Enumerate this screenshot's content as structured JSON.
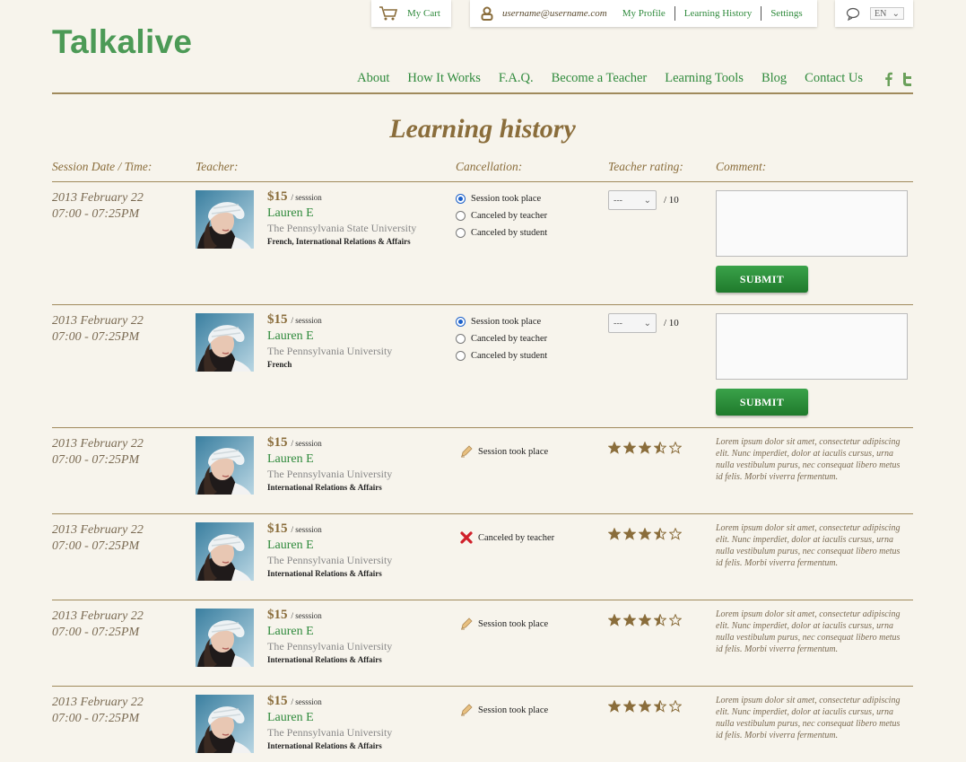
{
  "brand": {
    "logo": "Talkalive"
  },
  "topbar": {
    "cart": "My Cart",
    "email": "username@username.com",
    "links": [
      "My Profile",
      "Learning History",
      "Settings"
    ],
    "language": "EN"
  },
  "nav": [
    "About",
    "How It Works",
    "F.A.Q.",
    "Become a Teacher",
    "Learning Tools",
    "Blog",
    "Contact Us"
  ],
  "page_title": "Learning history",
  "columns": {
    "date": "Session Date / Time:",
    "teacher": "Teacher:",
    "cancellation": "Cancellation:",
    "rating": "Teacher rating:",
    "comment": "Comment:"
  },
  "pending_rows": [
    {
      "date": "2013 February 22",
      "time": "07:00 - 07:25PM",
      "price": "$15",
      "per": "/ sesssion",
      "teacher": "Lauren E",
      "university": "The Pennsylvania State University",
      "subjects": "French, International Relations & Affairs",
      "options": [
        "Session took place",
        "Canceled by teacher",
        "Canceled by student"
      ],
      "rating_value": "---",
      "rating_max": "/ 10",
      "submit": "SUBMIT"
    },
    {
      "date": "2013 February 22",
      "time": "07:00 - 07:25PM",
      "price": "$15",
      "per": "/ sesssion",
      "teacher": "Lauren E",
      "university": "The Pennsylvania University",
      "subjects": "French",
      "options": [
        "Session took place",
        "Canceled by teacher",
        "Canceled by student"
      ],
      "rating_value": "---",
      "rating_max": "/ 10",
      "submit": "SUBMIT"
    }
  ],
  "rated_rows": [
    {
      "date": "2013 February 22",
      "time": "07:00 - 07:25PM",
      "price": "$15",
      "per": "/ sesssion",
      "teacher": "Lauren E",
      "university": "The Pennsylvania University",
      "subjects": "International Relations & Affairs",
      "status": "Session took place",
      "status_icon": "pencil-check-icon",
      "rating": 3.5,
      "comment": "Lorem ipsum dolor sit amet, consectetur adipiscing elit. Nunc imperdiet, dolor at iaculis cursus, urna nulla vestibulum purus, nec consequat libero metus id felis. Morbi viverra fermentum."
    },
    {
      "date": "2013 February 22",
      "time": "07:00 - 07:25PM",
      "price": "$15",
      "per": "/ sesssion",
      "teacher": "Lauren E",
      "university": "The Pennsylvania University",
      "subjects": "International Relations & Affairs",
      "status": "Canceled by teacher",
      "status_icon": "red-x-icon",
      "rating": 3.5,
      "comment": "Lorem ipsum dolor sit amet, consectetur adipiscing elit. Nunc imperdiet, dolor at iaculis cursus, urna nulla vestibulum purus, nec consequat libero metus id felis. Morbi viverra fermentum."
    },
    {
      "date": "2013 February 22",
      "time": "07:00 - 07:25PM",
      "price": "$15",
      "per": "/ sesssion",
      "teacher": "Lauren E",
      "university": "The Pennsylvania University",
      "subjects": "International Relations & Affairs",
      "status": "Session took place",
      "status_icon": "pencil-check-icon",
      "rating": 3.5,
      "comment": "Lorem ipsum dolor sit amet, consectetur adipiscing elit. Nunc imperdiet, dolor at iaculis cursus, urna nulla vestibulum purus, nec consequat libero metus id felis. Morbi viverra fermentum."
    },
    {
      "date": "2013 February 22",
      "time": "07:00 - 07:25PM",
      "price": "$15",
      "per": "/ sesssion",
      "teacher": "Lauren E",
      "university": "The Pennsylvania University",
      "subjects": "International Relations & Affairs",
      "status": "Session took place",
      "status_icon": "pencil-check-icon",
      "rating": 3.5,
      "comment": "Lorem ipsum dolor sit amet, consectetur adipiscing elit. Nunc imperdiet, dolor at iaculis cursus, urna nulla vestibulum purus, nec consequat libero metus id felis. Morbi viverra fermentum."
    }
  ],
  "colors": {
    "brand_green": "#4c9a56",
    "link_green": "#2f8a3c",
    "accent_brown": "#8a6d3b",
    "background": "#f7f4ec"
  }
}
